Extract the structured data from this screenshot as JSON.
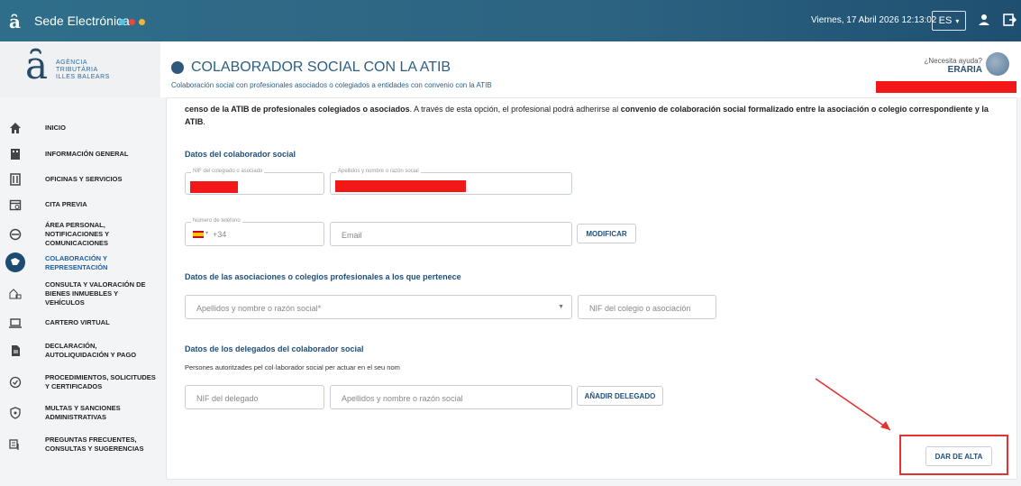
{
  "topbar": {
    "brand": "Sede Electrónica",
    "date": "Viernes, 17 Abril 2026 12:13:02",
    "lang": "ES",
    "lang_caret": "▾"
  },
  "logo": {
    "line1": "AGÈNCIA",
    "line2": "TRIBUTÀRIA",
    "line3": "ILLES BALEARS"
  },
  "page": {
    "title": "COLABORADOR SOCIAL CON LA ATIB",
    "subtitle": "Colaboración social con profesionales asociados o colegiados a entidades con convenio con la ATIB"
  },
  "help": {
    "question": "¿Necesita ayuda?",
    "name": "ERARIA"
  },
  "sidebar": {
    "items": [
      {
        "label": "INICIO",
        "icon": "home-icon"
      },
      {
        "label": "INFORMACIÓN GENERAL",
        "icon": "building-icon"
      },
      {
        "label": "OFICINAS Y SERVICIOS",
        "icon": "office-icon"
      },
      {
        "label": "CITA PREVIA",
        "icon": "calendar-icon"
      },
      {
        "label": "ÁREA PERSONAL, NOTIFICACIONES Y COMUNICACIONES",
        "icon": "user-icon"
      },
      {
        "label": "COLABORACIÓN Y REPRESENTACIÓN",
        "icon": "handshake-icon",
        "active": true
      },
      {
        "label": "CONSULTA Y VALORACIÓN DE BIENES INMUEBLES Y VEHÍCULOS",
        "icon": "house-car-icon"
      },
      {
        "label": "CARTERO VIRTUAL",
        "icon": "laptop-icon"
      },
      {
        "label": "DECLARACIÓN, AUTOLIQUIDACIÓN Y PAGO",
        "icon": "document-icon"
      },
      {
        "label": "PROCEDIMIENTOS, SOLICITUDES Y CERTIFICADOS",
        "icon": "check-circle-icon"
      },
      {
        "label": "MULTAS Y SANCIONES ADMINISTRATIVAS",
        "icon": "shield-icon"
      },
      {
        "label": "PREGUNTAS FRECUENTES, CONSULTAS Y SUGERENCIAS",
        "icon": "faq-icon"
      }
    ]
  },
  "intro": {
    "p1": "censo de la ATIB de profesionales colegiados o asociados",
    "p2": ". A través de esta opción, el profesional podrá adherirse al ",
    "p3": "convenio de colaboración social formalizado entre la asociación o colegio correspondiente y la ATIB",
    "p4": "."
  },
  "section1": {
    "title": "Datos del colaborador social",
    "nif_label": "NIF del colegiado o asociado",
    "name_label": "Apellidos y nombre o razón social",
    "phone_label": "Número de teléfono",
    "phone_prefix": "+34",
    "email_placeholder": "Email",
    "modify_button": "MODIFICAR"
  },
  "section2": {
    "title": "Datos de las asociaciones o colegios profesionales a los que pertenece",
    "select_placeholder": "Apellidos y nombre o razón social*",
    "nif_placeholder": "NIF del colegio o asociación"
  },
  "section3": {
    "title": "Datos de los delegados del colaborador social",
    "note": "Persones autoritzades pel col·laborador social per actuar en el seu nom",
    "nif_placeholder": "NIF del delegado",
    "name_placeholder": "Apellidos y nombre o razón social",
    "add_button": "AÑADIR DELEGADO"
  },
  "submit_button": "DAR DE ALTA",
  "colors": {
    "brand_blue": "#2c5f85",
    "highlight_red": "#e23232",
    "redaction": "#f21818"
  }
}
